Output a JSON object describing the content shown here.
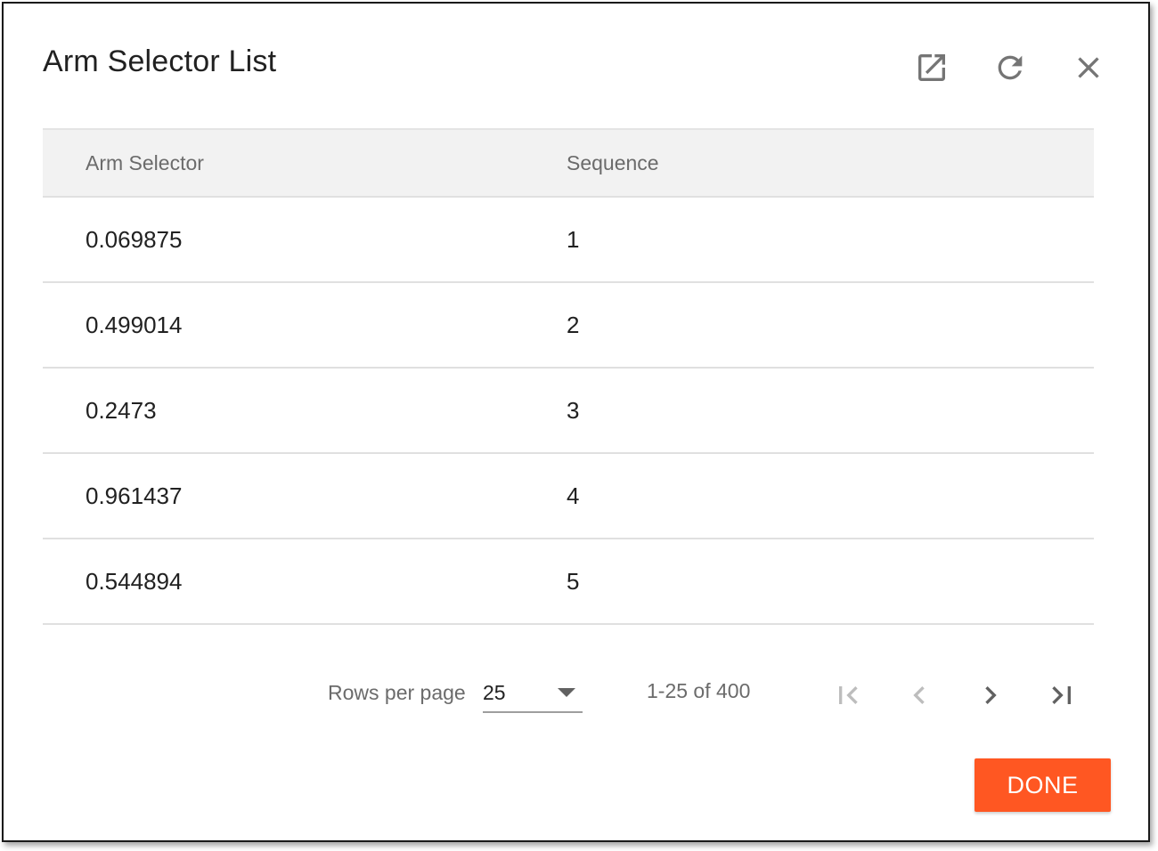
{
  "dialog": {
    "title": "Arm Selector List",
    "icons": [
      "open-in-new-icon",
      "refresh-icon",
      "close-icon"
    ]
  },
  "table": {
    "columns": [
      "Arm Selector",
      "Sequence"
    ],
    "rows": [
      [
        "0.069875",
        "1"
      ],
      [
        "0.499014",
        "2"
      ],
      [
        "0.2473",
        "3"
      ],
      [
        "0.961437",
        "4"
      ],
      [
        "0.544894",
        "5"
      ]
    ]
  },
  "pagination": {
    "rows_per_page_label": "Rows per page",
    "rows_per_page_value": "25",
    "range_text": "1-25 of 400"
  },
  "footer": {
    "done_label": "DONE"
  },
  "colors": {
    "accent": "#ff5722",
    "icon_gray": "#757575",
    "disabled_gray": "#bdbdbd",
    "header_bg": "#f2f2f2"
  }
}
